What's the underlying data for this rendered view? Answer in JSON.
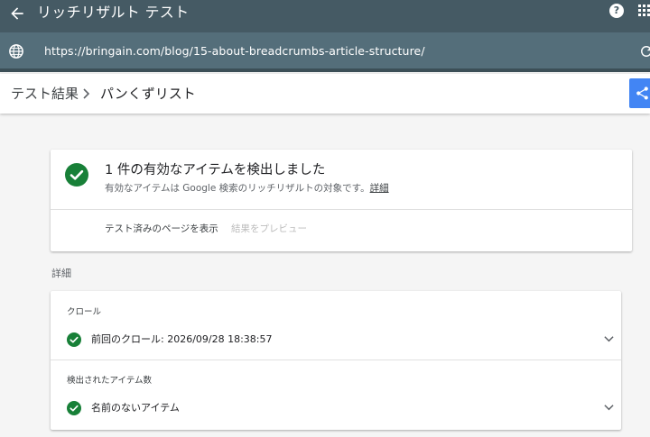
{
  "appbar": {
    "title": "リッチリザルト テスト",
    "back_icon": "arrow-back-icon",
    "help_icon": "help-icon",
    "help_glyph": "?",
    "apps_icon": "apps-grid-icon"
  },
  "urlbar": {
    "url": "https://bringain.com/blog/15-about-breadcrumbs-article-structure/",
    "globe_icon": "globe-icon",
    "refresh_icon": "refresh-icon"
  },
  "breadcrumb": {
    "parent": "テスト結果",
    "current": "パンくずリスト",
    "share_icon": "share-icon"
  },
  "summary": {
    "headline": "1 件の有効なアイテムを検出しました",
    "subtext": "有効なアイテムは Google 検索のリッチリザルトの対象です。",
    "more_link": "詳細",
    "action_view_page": "テスト済みのページを表示",
    "action_preview": "結果をプレビュー"
  },
  "details": {
    "section_label": "詳細",
    "crawl_caption": "クロール",
    "crawl_status": "前回のクロール: 2026/09/28 18:38:57",
    "items_caption": "検出されたアイテム数",
    "item_name": "名前のないアイテム"
  },
  "colors": {
    "appbar": "#455a64",
    "urlbar": "#546e7a",
    "success": "#188038",
    "share": "#4285f4"
  }
}
